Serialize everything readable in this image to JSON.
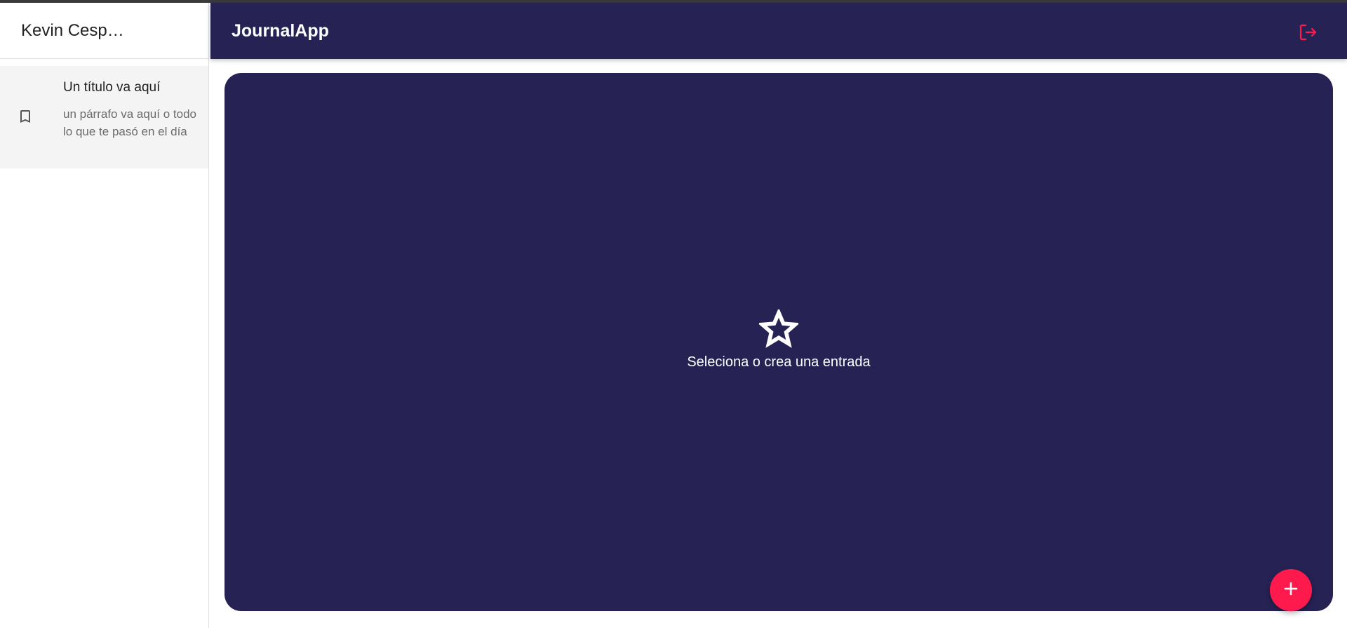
{
  "sidebar": {
    "user_name": "Kevin Cespe…",
    "entries": [
      {
        "icon": "bookmark-icon",
        "title": "Un título va aquí",
        "body": "un párrafo va aquí o todo lo que te pasó en el día"
      }
    ]
  },
  "header": {
    "app_title": "JournalApp",
    "logout_icon": "logout-icon"
  },
  "main": {
    "empty_icon": "star-icon",
    "empty_message": "Seleciona o crea una entrada",
    "fab_icon": "plus-icon"
  },
  "colors": {
    "primary": "#262254",
    "accent": "#ff1a4d",
    "sidebar_item_bg": "#f4f4f4"
  }
}
